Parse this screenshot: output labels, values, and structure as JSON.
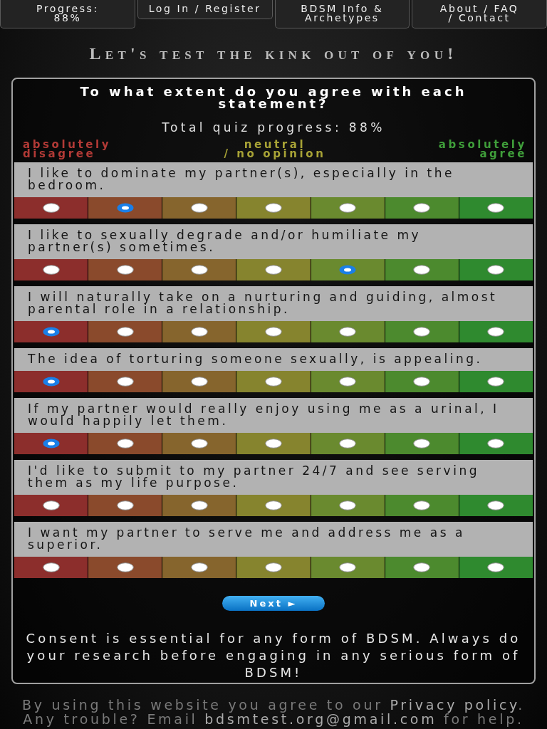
{
  "nav": [
    {
      "label": "Progress:\n88%"
    },
    {
      "label": "Log In / Register"
    },
    {
      "label": "BDSM Info &\nArchetypes"
    },
    {
      "label": "About / FAQ\n/ Contact"
    }
  ],
  "tagline": "Let's test the kink out of you!",
  "quiz": {
    "heading": "To what extent do you agree with each statement?",
    "progress": "Total quiz progress: 88%",
    "scale_labels": [
      {
        "text": "absolutely\ndisagree",
        "color": "#b23a36"
      },
      {
        "text": "neutral\n/ no opinion",
        "color": "#a8a336"
      },
      {
        "text": "absolutely\nagree",
        "color": "#3f9e3a"
      }
    ],
    "answer_scale": [
      {
        "color": "#8c2e2c"
      },
      {
        "color": "#8a4a2c"
      },
      {
        "color": "#86652d"
      },
      {
        "color": "#86842e"
      },
      {
        "color": "#6a8a2f"
      },
      {
        "color": "#4c8a2e"
      },
      {
        "color": "#2f8a2f"
      }
    ],
    "questions": [
      {
        "text": "I like to dominate my partner(s), especially in the bedroom.",
        "options": [
          {
            "selected": false
          },
          {
            "selected": true
          },
          {
            "selected": false
          },
          {
            "selected": false
          },
          {
            "selected": false
          },
          {
            "selected": false
          },
          {
            "selected": false
          }
        ]
      },
      {
        "text": "I like to sexually degrade and/or humiliate my partner(s) sometimes.",
        "options": [
          {
            "selected": false
          },
          {
            "selected": false
          },
          {
            "selected": false
          },
          {
            "selected": false
          },
          {
            "selected": true
          },
          {
            "selected": false
          },
          {
            "selected": false
          }
        ]
      },
      {
        "text": "I will naturally take on a nurturing and guiding, almost parental role in a relationship.",
        "options": [
          {
            "selected": true
          },
          {
            "selected": false
          },
          {
            "selected": false
          },
          {
            "selected": false
          },
          {
            "selected": false
          },
          {
            "selected": false
          },
          {
            "selected": false
          }
        ]
      },
      {
        "text": "The idea of torturing someone sexually, is appealing.",
        "options": [
          {
            "selected": true
          },
          {
            "selected": false
          },
          {
            "selected": false
          },
          {
            "selected": false
          },
          {
            "selected": false
          },
          {
            "selected": false
          },
          {
            "selected": false
          }
        ]
      },
      {
        "text": "If my partner would really enjoy using me as a urinal, I would happily let them.",
        "options": [
          {
            "selected": true
          },
          {
            "selected": false
          },
          {
            "selected": false
          },
          {
            "selected": false
          },
          {
            "selected": false
          },
          {
            "selected": false
          },
          {
            "selected": false
          }
        ]
      },
      {
        "text": "I'd like to submit to my partner 24/7 and see serving them as my life purpose.",
        "options": [
          {
            "selected": false
          },
          {
            "selected": false
          },
          {
            "selected": false
          },
          {
            "selected": false
          },
          {
            "selected": false
          },
          {
            "selected": false
          },
          {
            "selected": false
          }
        ]
      },
      {
        "text": "I want my partner to serve me and address me as a superior.",
        "options": [
          {
            "selected": false
          },
          {
            "selected": false
          },
          {
            "selected": false
          },
          {
            "selected": false
          },
          {
            "selected": false
          },
          {
            "selected": false
          },
          {
            "selected": false
          }
        ]
      }
    ],
    "next_button": "Next ►",
    "consent": "Consent is essential for any form of BDSM. Always do your research before engaging in any serious form of BDSM!"
  },
  "footer": {
    "parts": [
      {
        "kind": "text",
        "text": "By using this website you agree to our "
      },
      {
        "kind": "link",
        "text": "Privacy policy"
      },
      {
        "kind": "text",
        "text": ". Any trouble? Email "
      },
      {
        "kind": "link",
        "text": "bdsmtest.org@gmail.com"
      },
      {
        "kind": "text",
        "text": " for help."
      }
    ]
  }
}
